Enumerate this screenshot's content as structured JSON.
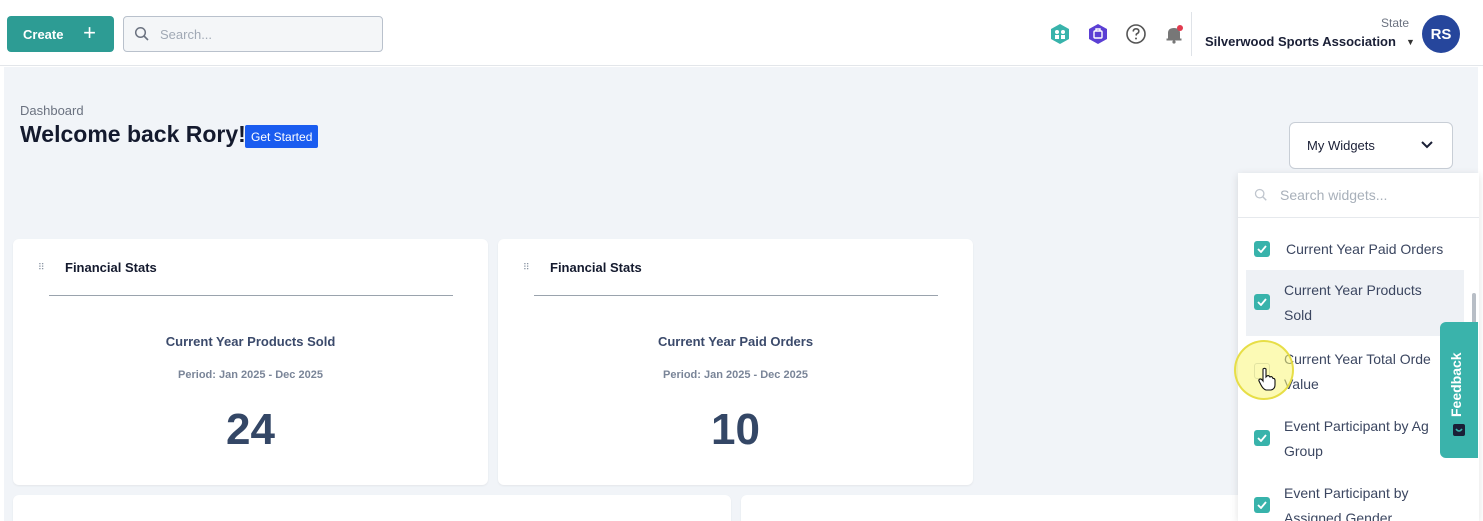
{
  "topbar": {
    "create_label": "Create",
    "search_placeholder": "Search...",
    "state_label": "State",
    "org_name": "Silverwood Sports Association",
    "avatar_initials": "RS"
  },
  "page": {
    "breadcrumb": "Dashboard",
    "welcome": "Welcome back Rory!",
    "get_started": "Get Started",
    "my_widgets_label": "My Widgets"
  },
  "cards": [
    {
      "title": "Financial Stats",
      "stat_label": "Current Year Products Sold",
      "period": "Period: Jan 2025 - Dec 2025",
      "value": "24"
    },
    {
      "title": "Financial Stats",
      "stat_label": "Current Year Paid Orders",
      "period": "Period: Jan 2025 - Dec 2025",
      "value": "10"
    }
  ],
  "widget_dropdown": {
    "search_placeholder": "Search widgets...",
    "items": [
      {
        "line1": "Current Year Paid Orders",
        "line2": "",
        "checked": true
      },
      {
        "line1": "Current Year Products",
        "line2": "Sold",
        "checked": true
      },
      {
        "line1": "Current Year Total Orde",
        "line2": "Value",
        "checked": false
      },
      {
        "line1": "Event Participant by Ag",
        "line2": "Group",
        "checked": true
      },
      {
        "line1": "Event Participant by",
        "line2": "Assigned Gender",
        "checked": true
      }
    ]
  },
  "feedback_label": "Feedback",
  "colors": {
    "accent": "#38b3ab",
    "primary": "#1a5cf0",
    "avatar": "#26469c"
  }
}
